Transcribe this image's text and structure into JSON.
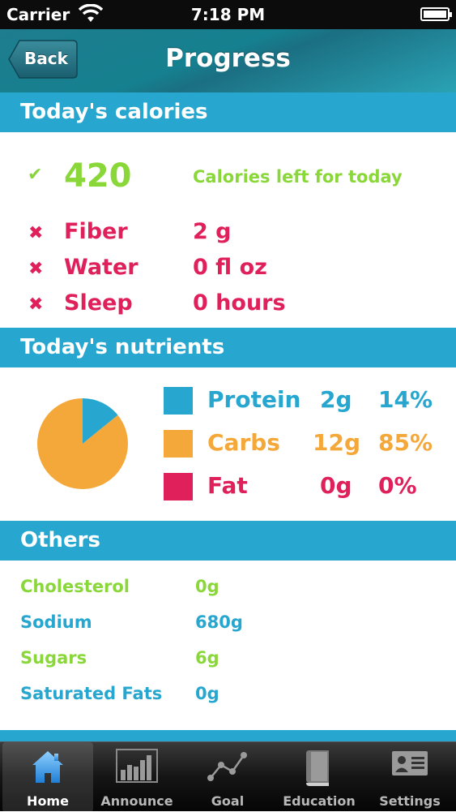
{
  "status_bar": {
    "carrier": "Carrier",
    "time": "7:18 PM"
  },
  "nav": {
    "back_label": "Back",
    "title": "Progress"
  },
  "calories_section": {
    "header": "Today's calories",
    "calories_value": "420",
    "calories_label": "Calories left for today",
    "items": [
      {
        "label": "Fiber",
        "value": "2 g"
      },
      {
        "label": "Water",
        "value": "0 fl oz"
      },
      {
        "label": "Sleep",
        "value": "0 hours"
      }
    ]
  },
  "nutrients_section": {
    "header": "Today's nutrients",
    "items": [
      {
        "label": "Protein",
        "amount": "2g",
        "percent": "14%",
        "color": "#27a7cf"
      },
      {
        "label": "Carbs",
        "amount": "12g",
        "percent": "85%",
        "color": "#f5a83a"
      },
      {
        "label": "Fat",
        "amount": "0g",
        "percent": "0%",
        "color": "#e0205b"
      }
    ]
  },
  "chart_data": {
    "type": "pie",
    "categories": [
      "Protein",
      "Carbs",
      "Fat"
    ],
    "values": [
      14,
      85,
      0
    ],
    "colors": [
      "#27a7cf",
      "#f5a83a",
      "#e0205b"
    ]
  },
  "others_section": {
    "header": "Others",
    "items": [
      {
        "label": "Cholesterol",
        "value": "0g",
        "color": "#8ad739"
      },
      {
        "label": "Sodium",
        "value": "680g",
        "color": "#27a7cf"
      },
      {
        "label": "Sugars",
        "value": "6g",
        "color": "#8ad739"
      },
      {
        "label": "Saturated Fats",
        "value": "0g",
        "color": "#27a7cf"
      }
    ]
  },
  "tab_bar": {
    "tabs": [
      {
        "label": "Home",
        "icon": "home-icon",
        "active": true
      },
      {
        "label": "Announce",
        "icon": "bar-chart-icon",
        "active": false
      },
      {
        "label": "Goal",
        "icon": "line-graph-icon",
        "active": false
      },
      {
        "label": "Education",
        "icon": "book-icon",
        "active": false
      },
      {
        "label": "Settings",
        "icon": "id-card-icon",
        "active": false
      }
    ]
  }
}
